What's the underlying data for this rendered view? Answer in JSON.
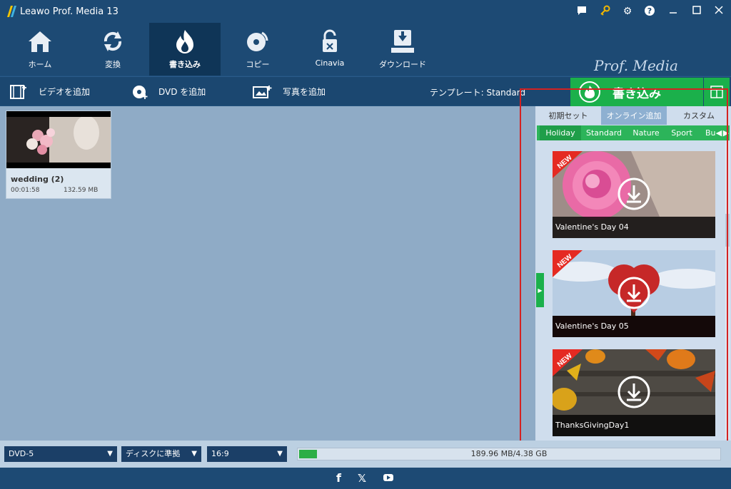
{
  "app": {
    "title": "Leawo Prof. Media 13"
  },
  "nav": {
    "items": [
      {
        "label": "ホーム"
      },
      {
        "label": "変換"
      },
      {
        "label": "書き込み"
      },
      {
        "label": "コピー"
      },
      {
        "label": "Cinavia"
      },
      {
        "label": "ダウンロード"
      }
    ],
    "brand": "Prof. Media"
  },
  "toolbar": {
    "add_video": "ビデオを追加",
    "add_dvd": "DVD を追加",
    "add_photo": "写真を追加",
    "template": "テンプレート: Standard",
    "burn": "書き込み"
  },
  "video": {
    "name": "wedding (2)",
    "duration": "00:01:58",
    "size": "132.59 MB"
  },
  "panel": {
    "tabs": [
      "初期セット",
      "オンライン追加",
      "カスタム"
    ],
    "categories": [
      "Holiday",
      "Standard",
      "Nature",
      "Sport",
      "Bu"
    ],
    "templates": [
      {
        "title": "Valentine's Day 04",
        "badge": "NEW"
      },
      {
        "title": "Valentine's Day 05",
        "badge": "NEW"
      },
      {
        "title": "ThanksGivingDay1",
        "badge": "NEW"
      }
    ]
  },
  "bottom": {
    "disc_type": "DVD-5",
    "quality": "ディスクに準拠",
    "aspect": "16:9",
    "usage": "189.96 MB/4.38 GB",
    "usage_fraction": 0.042
  },
  "colors": {
    "accent": "#1bb04b",
    "nav_bg": "#1d4a74",
    "highlight": "#d42121"
  }
}
